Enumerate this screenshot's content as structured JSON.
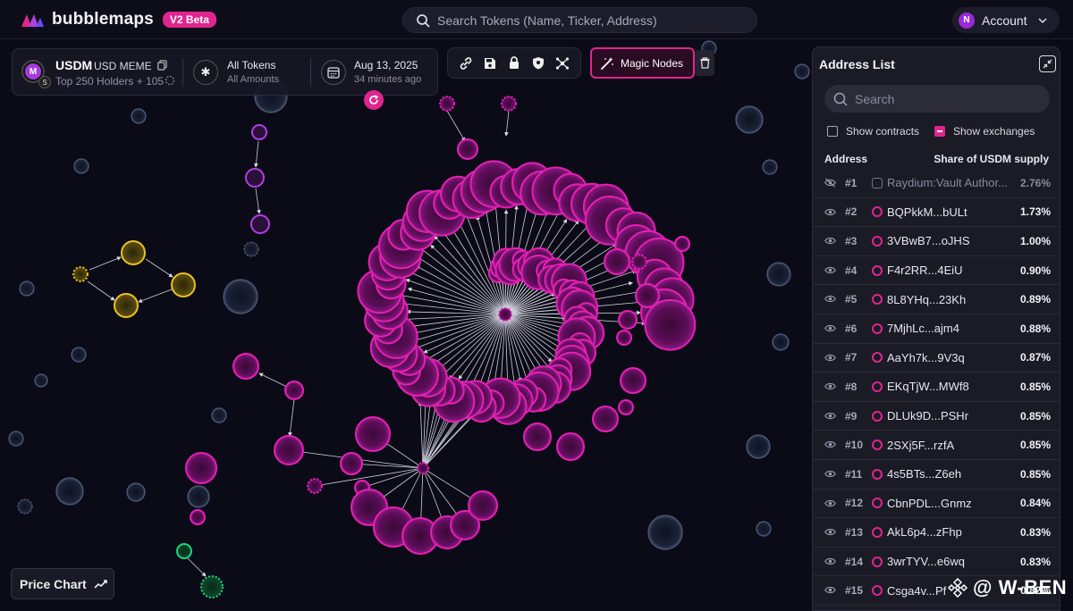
{
  "header": {
    "brand": "bubblemaps",
    "badge": "V2 Beta",
    "search_placeholder": "Search Tokens (Name, Ticker, Address)",
    "account_initial": "N",
    "account_label": "Account"
  },
  "token": {
    "logo_letter": "M",
    "chain_letter": "S",
    "symbol": "USDM",
    "name": "USD MEME",
    "holders": "Top 250 Holders + 105"
  },
  "filters": {
    "tokens_label": "All Tokens",
    "amounts_label": "All Amounts",
    "date": "Aug 13, 2025",
    "date_relative": "34 minutes ago"
  },
  "toolbar": {
    "magic_nodes": "Magic Nodes",
    "icons": [
      "link-icon",
      "save-icon",
      "lock-icon",
      "shield-icon",
      "network-icon"
    ]
  },
  "panel": {
    "title": "Address List",
    "search_placeholder": "Search",
    "show_contracts": "Show contracts",
    "show_exchanges": "Show exchanges",
    "col_address": "Address",
    "col_share": "Share of USDM supply",
    "rows": [
      {
        "rank": "#1",
        "address": "Raydium:Vault Author...",
        "share": "2.76%"
      },
      {
        "rank": "#2",
        "address": "BQPkkM...bULt",
        "share": "1.73%"
      },
      {
        "rank": "#3",
        "address": "3VBwB7...oJHS",
        "share": "1.00%"
      },
      {
        "rank": "#4",
        "address": "F4r2RR...4EiU",
        "share": "0.90%"
      },
      {
        "rank": "#5",
        "address": "8L8YHq...23Kh",
        "share": "0.89%"
      },
      {
        "rank": "#6",
        "address": "7MjhLc...ajm4",
        "share": "0.88%"
      },
      {
        "rank": "#7",
        "address": "AaYh7k...9V3q",
        "share": "0.87%"
      },
      {
        "rank": "#8",
        "address": "EKqTjW...MWf8",
        "share": "0.85%"
      },
      {
        "rank": "#9",
        "address": "DLUk9D...PSHr",
        "share": "0.85%"
      },
      {
        "rank": "#10",
        "address": "2SXj5F...rzfA",
        "share": "0.85%"
      },
      {
        "rank": "#11",
        "address": "4s5BTs...Z6eh",
        "share": "0.85%"
      },
      {
        "rank": "#12",
        "address": "CbnPDL...Gnmz",
        "share": "0.84%"
      },
      {
        "rank": "#13",
        "address": "AkL6p4...zFhp",
        "share": "0.83%"
      },
      {
        "rank": "#14",
        "address": "3wrTYV...e6wq",
        "share": "0.83%"
      },
      {
        "rank": "#15",
        "address": "Csga4v...Pf",
        "share": "0.82%"
      }
    ]
  },
  "price_chart": "Price Chart",
  "watermark": "@ W-BEN",
  "colors": {
    "accent": "#e0258f",
    "background": "#0b0b17",
    "bubble_pink": "#e61fb4",
    "bubble_yellow": "#e8c21e",
    "bubble_green": "#20d27a",
    "bubble_purple": "#b040e0"
  }
}
